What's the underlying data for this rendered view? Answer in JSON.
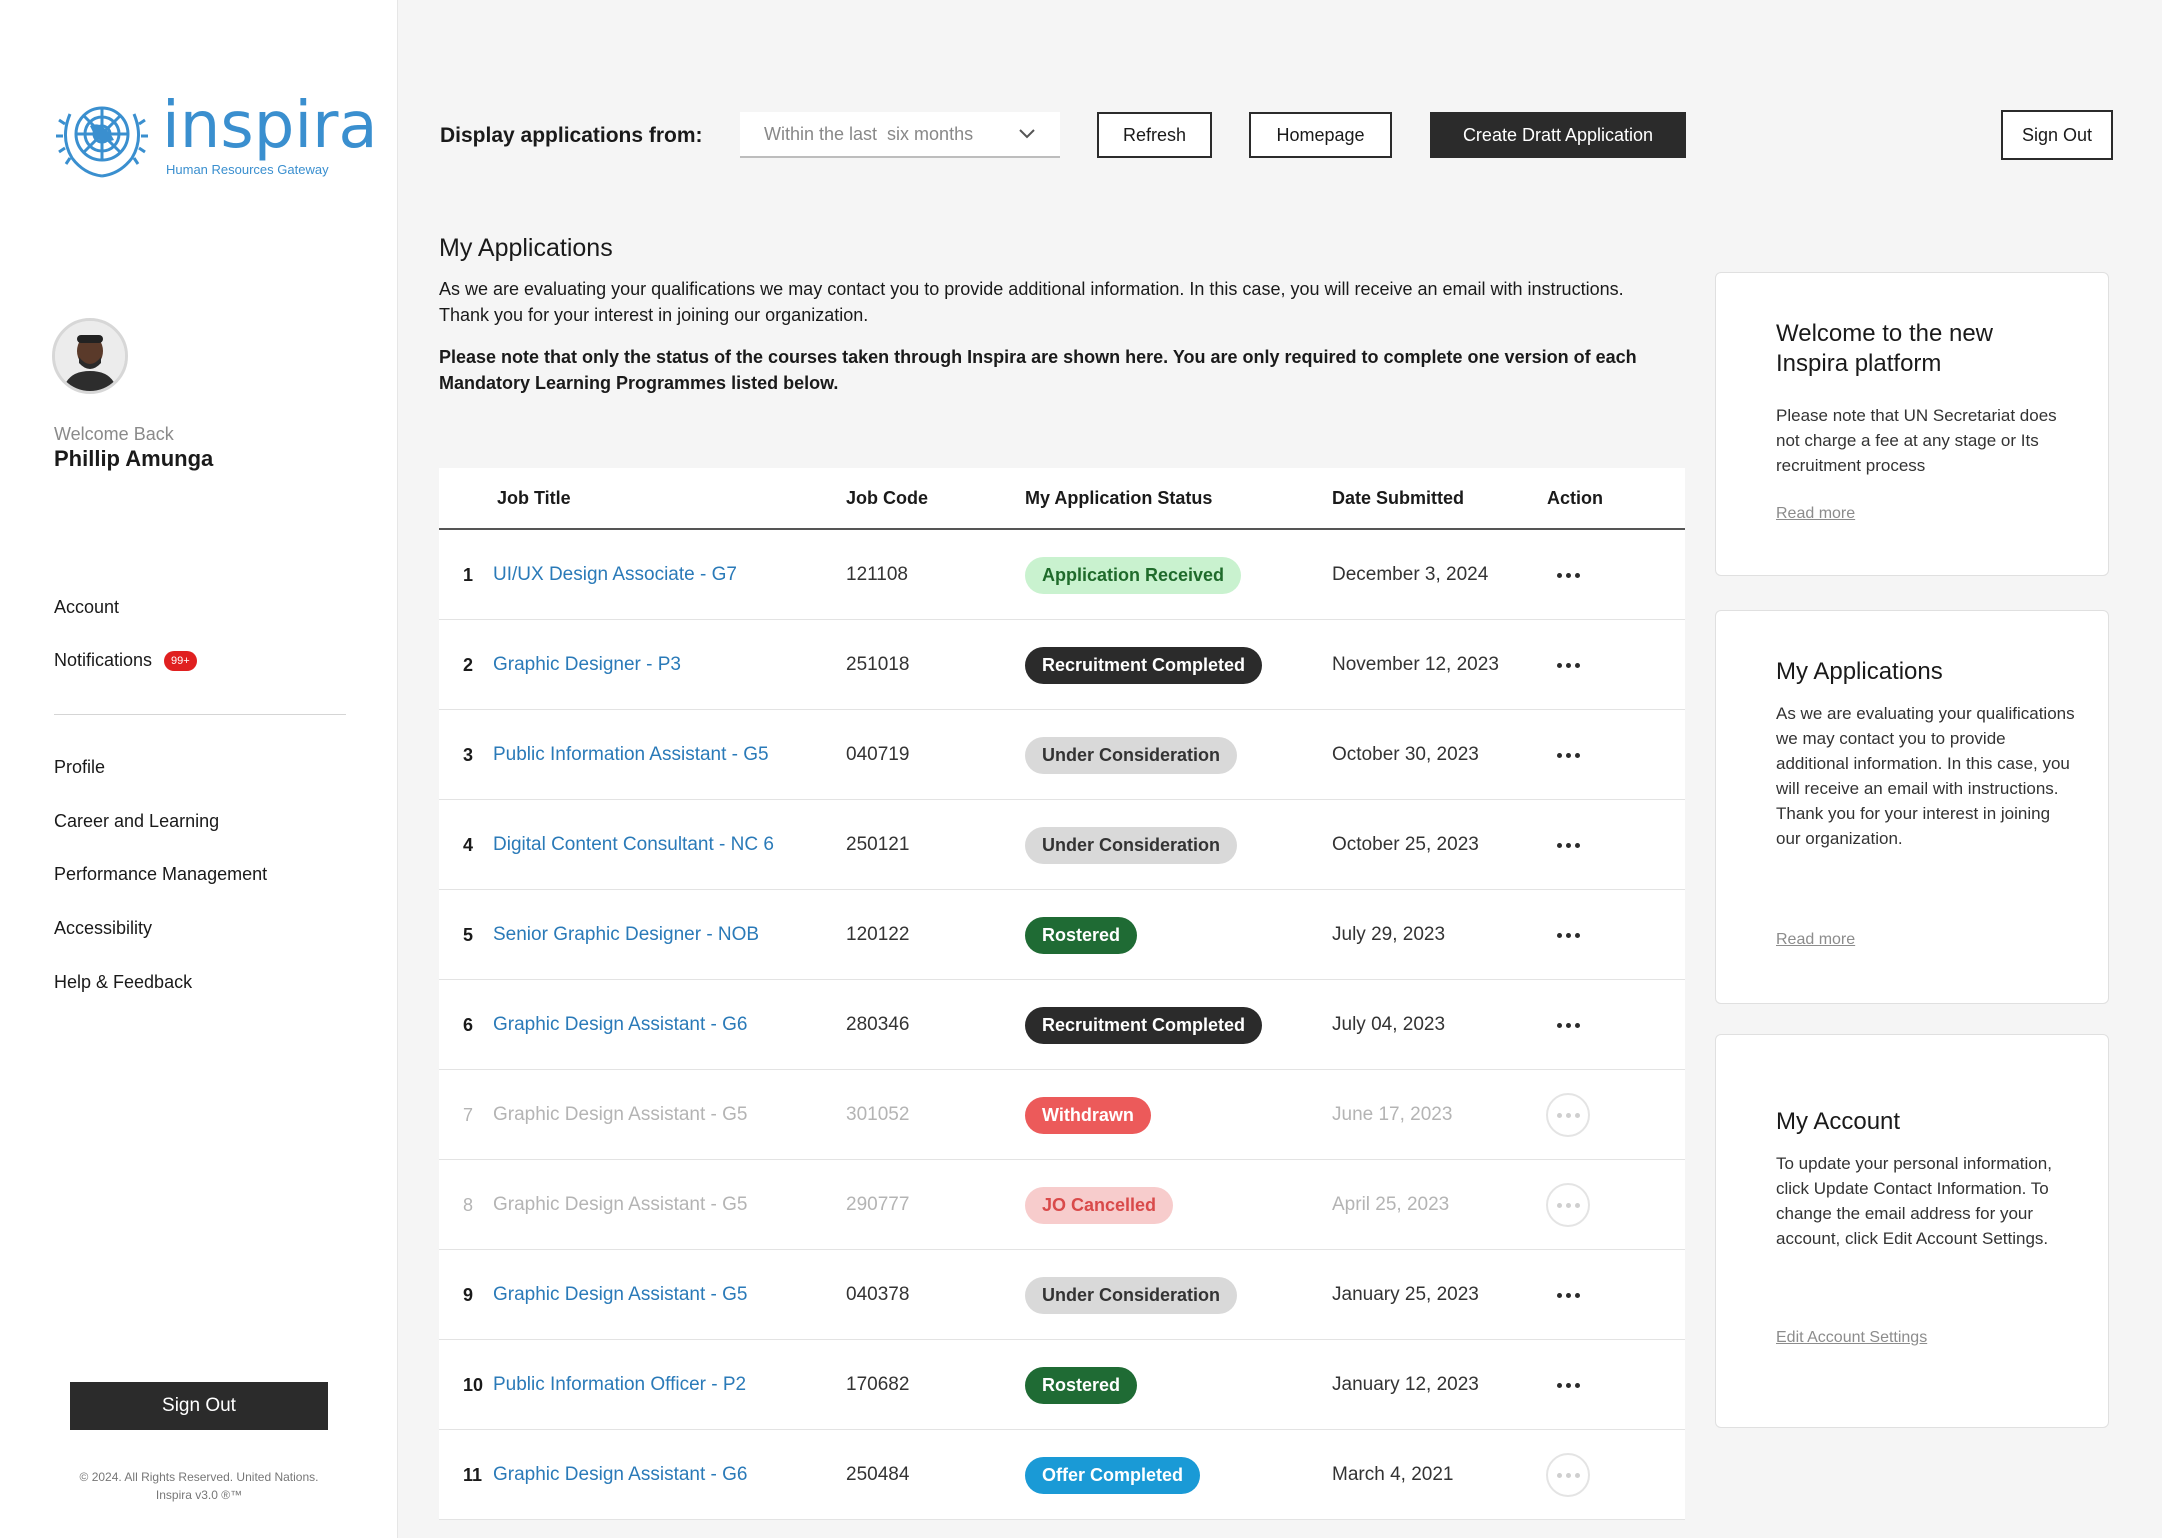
{
  "brand": {
    "wordmark": "inspira",
    "tagline": "Human Resources Gateway",
    "color": "#3a8fcf"
  },
  "user": {
    "welcome": "Welcome Back",
    "name": "Phillip Amunga"
  },
  "sidebar": {
    "nav_primary": [
      {
        "label": "Account"
      },
      {
        "label": "Notifications",
        "badge": "99+"
      }
    ],
    "nav_secondary": [
      {
        "label": "Profile"
      },
      {
        "label": "Career and Learning"
      },
      {
        "label": "Performance Management"
      },
      {
        "label": "Accessibility"
      },
      {
        "label": "Help & Feedback"
      }
    ],
    "sign_out": "Sign Out",
    "copyright_line1": "© 2024. All Rights Reserved. United Nations.",
    "copyright_line2": "Inspira v3.0 ®™"
  },
  "toolbar": {
    "display_label": "Display applications from:",
    "filter_value": "Within the last  six months",
    "refresh": "Refresh",
    "homepage": "Homepage",
    "create": "Create Dratt Application",
    "sign_out": "Sign Out"
  },
  "main": {
    "title": "My Applications",
    "intro": "As we are evaluating your qualifications we may contact you to provide additional information. In this case, you will receive an email with instructions. Thank you for your interest in joining our organization.",
    "note": "Please note that only the status of the courses taken through Inspira are shown here. You are only required to complete one version of each Mandatory Learning Programmes listed below."
  },
  "table": {
    "headers": {
      "title": "Job Title",
      "code": "Job Code",
      "status": "My Application Status",
      "date": "Date Submitted",
      "action": "Action"
    },
    "rows": [
      {
        "num": "1",
        "title": "UI/UX Design Associate - G7",
        "code": "121108",
        "status": "Application Received",
        "date": "December 3, 2024",
        "dim": false,
        "pill_bg": "#c9f2cf",
        "pill_fg": "#1f6b2b"
      },
      {
        "num": "2",
        "title": "Graphic Designer - P3",
        "code": "251018",
        "status": "Recruitment Completed",
        "date": "November 12, 2023",
        "dim": false,
        "pill_bg": "#2b2b2b",
        "pill_fg": "#ffffff"
      },
      {
        "num": "3",
        "title": "Public Information Assistant - G5",
        "code": "040719",
        "status": "Under Consideration",
        "date": "October 30, 2023",
        "dim": false,
        "pill_bg": "#d9d9d9",
        "pill_fg": "#333333"
      },
      {
        "num": "4",
        "title": "Digital Content Consultant - NC 6",
        "code": "250121",
        "status": "Under Consideration",
        "date": "October 25, 2023",
        "dim": false,
        "pill_bg": "#d9d9d9",
        "pill_fg": "#333333"
      },
      {
        "num": "5",
        "title": "Senior Graphic Designer - NOB",
        "code": "120122",
        "status": "Rostered",
        "date": "July 29, 2023",
        "dim": false,
        "pill_bg": "#1f6b34",
        "pill_fg": "#ffffff"
      },
      {
        "num": "6",
        "title": "Graphic Design Assistant - G6",
        "code": "280346",
        "status": "Recruitment Completed",
        "date": "July 04, 2023",
        "dim": false,
        "pill_bg": "#2b2b2b",
        "pill_fg": "#ffffff"
      },
      {
        "num": "7",
        "title": "Graphic Design Assistant - G5",
        "code": "301052",
        "status": "Withdrawn",
        "date": "June 17, 2023",
        "dim": true,
        "pill_bg": "#ec5a5a",
        "pill_fg": "#ffffff"
      },
      {
        "num": "8",
        "title": "Graphic Design Assistant - G5",
        "code": "290777",
        "status": "JO Cancelled",
        "date": "April 25, 2023",
        "dim": true,
        "pill_bg": "#f7cccc",
        "pill_fg": "#d94a4a"
      },
      {
        "num": "9",
        "title": "Graphic Design Assistant - G5",
        "code": "040378",
        "status": "Under Consideration",
        "date": "January 25, 2023",
        "dim": false,
        "pill_bg": "#d9d9d9",
        "pill_fg": "#333333"
      },
      {
        "num": "10",
        "title": "Public Information Officer - P2",
        "code": "170682",
        "status": "Rostered",
        "date": "January 12, 2023",
        "dim": false,
        "pill_bg": "#1f6b34",
        "pill_fg": "#ffffff"
      },
      {
        "num": "11",
        "title": "Graphic Design Assistant - G6",
        "code": "250484",
        "status": "Offer Completed",
        "date": "March 4, 2021",
        "dim": false,
        "ring_action": true,
        "pill_bg": "#1a9ad6",
        "pill_fg": "#ffffff"
      }
    ]
  },
  "cards": [
    {
      "title": "Welcome to the new Inspira platform",
      "text": "Please note that UN Secretariat does not charge a fee at any stage or Its recruitment process",
      "link": "Read more"
    },
    {
      "title": "My Applications",
      "text": "As we are evaluating your qualifications we may contact you to provide additional information. In this case, you will receive an email with instructions. Thank you for your interest in joining our organization.",
      "link": "Read more"
    },
    {
      "title": "My Account",
      "text": "To update your personal information, click Update Contact Information. To change the email address for your account, click Edit Account Settings.",
      "link": "Edit Account Settings"
    }
  ]
}
